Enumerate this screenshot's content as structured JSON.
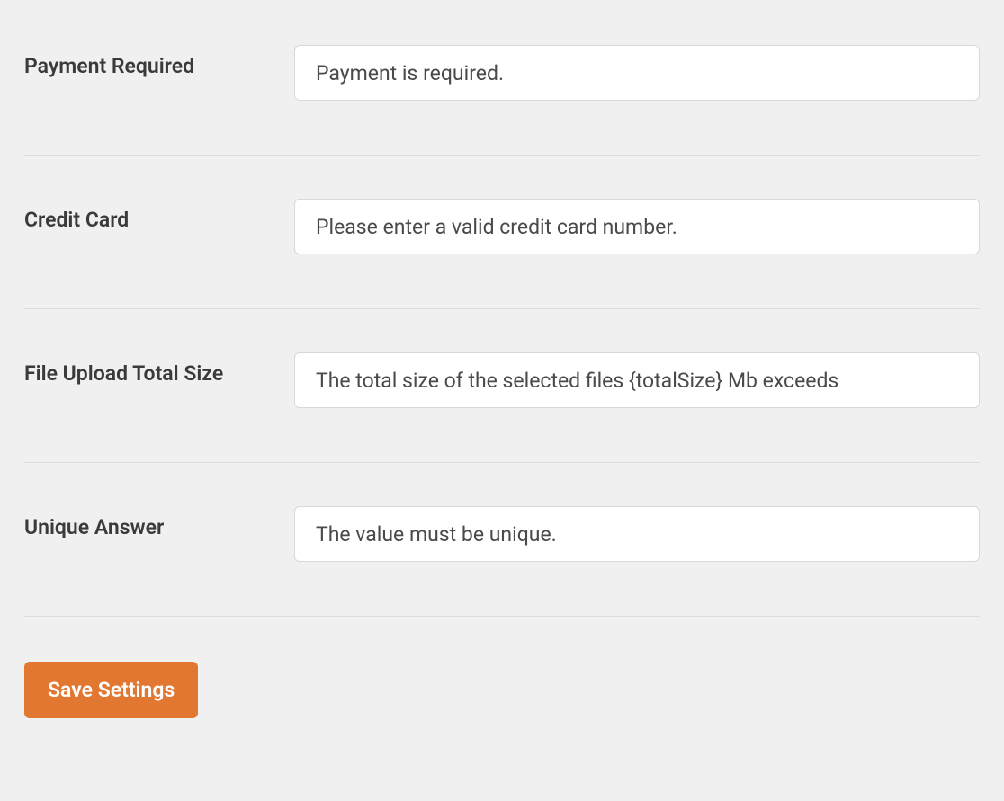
{
  "fields": {
    "payment_required": {
      "label": "Payment Required",
      "value": "Payment is required."
    },
    "credit_card": {
      "label": "Credit Card",
      "value": "Please enter a valid credit card number."
    },
    "file_upload_total_size": {
      "label": "File Upload Total Size",
      "value": "The total size of the selected files {totalSize} Mb exceeds "
    },
    "unique_answer": {
      "label": "Unique Answer",
      "value": "The value must be unique."
    }
  },
  "actions": {
    "save_label": "Save Settings"
  }
}
